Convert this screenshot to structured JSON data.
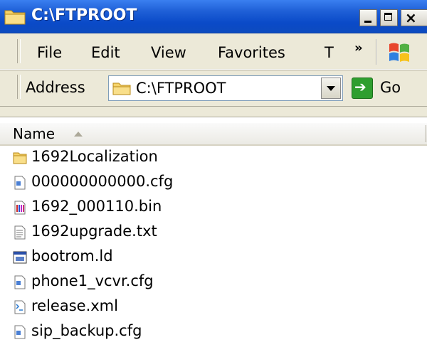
{
  "window": {
    "title": "C:\\FTPROOT"
  },
  "menu": {
    "items": [
      "File",
      "Edit",
      "View",
      "Favorites",
      "T"
    ],
    "chevron": "»"
  },
  "address": {
    "label": "Address",
    "value": "C:\\FTPROOT",
    "go_label": "Go"
  },
  "list": {
    "column_name": "Name",
    "files": [
      {
        "name": "1692Localization",
        "icon": "folder-icon"
      },
      {
        "name": "000000000000.cfg",
        "icon": "cfg-file-icon"
      },
      {
        "name": "1692_000110.bin",
        "icon": "bin-file-icon"
      },
      {
        "name": "1692upgrade.txt",
        "icon": "text-file-icon"
      },
      {
        "name": "bootrom.ld",
        "icon": "ld-file-icon"
      },
      {
        "name": "phone1_vcvr.cfg",
        "icon": "cfg-file-icon"
      },
      {
        "name": "release.xml",
        "icon": "xml-file-icon"
      },
      {
        "name": "sip_backup.cfg",
        "icon": "cfg-file-icon"
      }
    ]
  },
  "colors": {
    "titlebar": "#0a4ac8",
    "chrome": "#ece9d8",
    "folder": "#f2c94c"
  }
}
